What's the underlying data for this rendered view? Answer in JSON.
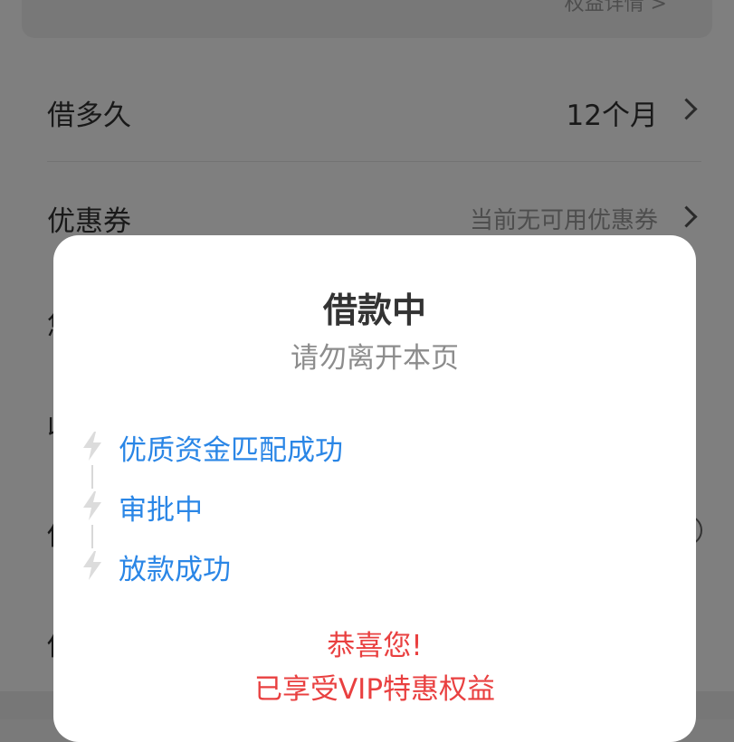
{
  "background": {
    "top_card_hint": "权益详情 >",
    "rows": [
      {
        "label": "借多久",
        "value": "12个月"
      },
      {
        "label": "优惠券",
        "value": "当前无可用优惠券"
      }
    ],
    "fragments": [
      "您",
      "收",
      "借",
      "借"
    ]
  },
  "modal": {
    "title": "借款中",
    "subtitle": "请勿离开本页",
    "steps": [
      {
        "label": "优质资金匹配成功",
        "icon": "lightning-icon"
      },
      {
        "label": "审批中",
        "icon": "lightning-icon"
      },
      {
        "label": "放款成功",
        "icon": "lightning-icon"
      }
    ],
    "congrats_line1": "恭喜您!",
    "congrats_line2": "已享受VIP特惠权益"
  },
  "colors": {
    "step_text": "#2a86e6",
    "congrats_text": "#e94040",
    "overlay": "rgba(0,0,0,0.5)"
  }
}
